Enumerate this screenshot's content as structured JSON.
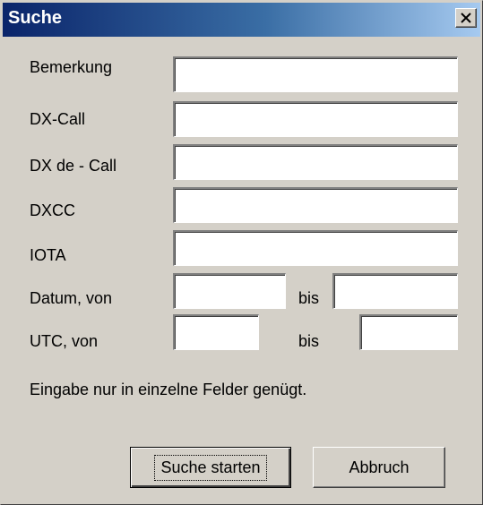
{
  "window": {
    "title": "Suche",
    "close_glyph": "close-icon"
  },
  "labels": {
    "bemerkung": "Bemerkung",
    "dx_call": "DX-Call",
    "dx_de_call": "DX de - Call",
    "dxcc": "DXCC",
    "iota": "IOTA",
    "datum_von": "Datum, von",
    "datum_bis": "bis",
    "utc_von": "UTC, von",
    "utc_bis": "bis"
  },
  "fields": {
    "bemerkung": "",
    "dx_call": "",
    "dx_de_call": "",
    "dxcc": "",
    "iota": "",
    "datum_von": "",
    "datum_bis": "",
    "utc_von": "",
    "utc_bis": ""
  },
  "hint": "Eingabe nur in einzelne Felder genügt.",
  "buttons": {
    "start": "Suche starten",
    "cancel": "Abbruch"
  },
  "colors": {
    "title_bar": "#0a246a",
    "dialog_face": "#d4d0c8"
  }
}
